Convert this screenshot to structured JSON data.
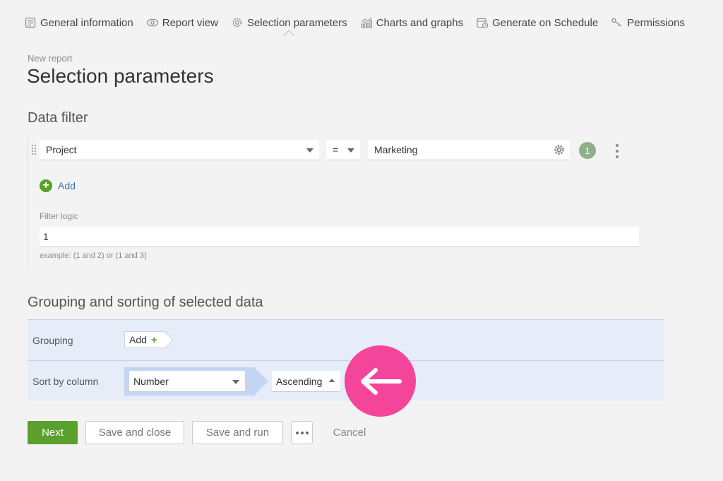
{
  "tabs": [
    {
      "label": "General information",
      "icon": "document-lines-icon"
    },
    {
      "label": "Report view",
      "icon": "eye-icon"
    },
    {
      "label": "Selection parameters",
      "icon": "gear-icon"
    },
    {
      "label": "Charts and graphs",
      "icon": "bar-chart-icon"
    },
    {
      "label": "Generate on Schedule",
      "icon": "calendar-clock-icon"
    },
    {
      "label": "Permissions",
      "icon": "key-icon"
    }
  ],
  "active_tab": "Selection parameters",
  "breadcrumb": "New report",
  "page_title": "Selection parameters",
  "data_filter": {
    "title": "Data filter",
    "condition": {
      "field": "Project",
      "operator": "=",
      "value": "Marketing",
      "index": "1"
    },
    "add_label": "Add",
    "logic_label": "Filter logic",
    "logic_value": "1",
    "logic_hint": "example: (1 and 2) or (1 and 3)"
  },
  "grouping": {
    "title": "Grouping and sorting of selected data",
    "grouping_label": "Grouping",
    "grouping_add": "Add",
    "sort_label": "Sort by column",
    "sort_column": "Number",
    "sort_order": "Ascending"
  },
  "buttons": {
    "next": "Next",
    "save_close": "Save and close",
    "save_run": "Save and run",
    "cancel": "Cancel"
  },
  "colors": {
    "accent_green": "#5aa02c",
    "highlight_pink": "#f4459b",
    "grid_bg": "#e6ecf8"
  }
}
